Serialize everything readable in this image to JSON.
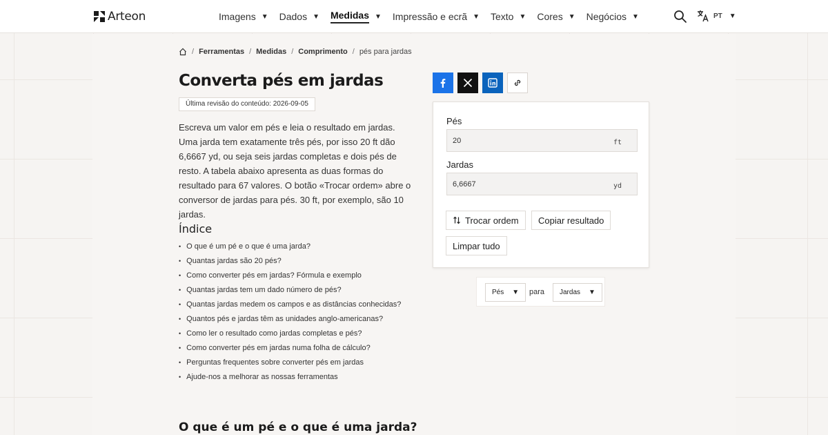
{
  "header": {
    "brand": "Arteon",
    "nav": [
      {
        "label": "Imagens",
        "active": false
      },
      {
        "label": "Dados",
        "active": false
      },
      {
        "label": "Medidas",
        "active": true
      },
      {
        "label": "Impressão e ecrã",
        "active": false
      },
      {
        "label": "Texto",
        "active": false
      },
      {
        "label": "Cores",
        "active": false
      },
      {
        "label": "Negócios",
        "active": false
      }
    ],
    "language": "PT",
    "icons": {
      "search": "search-icon",
      "language": "translate-icon",
      "home": "home-icon"
    }
  },
  "breadcrumb": {
    "items": [
      "Ferramentas",
      "Medidas",
      "Comprimento"
    ],
    "current": "pés para jardas"
  },
  "page": {
    "title": "Converta pés em jardas",
    "revision": "Última revisão do conteúdo: 2026-09-05",
    "intro": "Escreva um valor em pés e leia o resultado em jardas. Uma jarda tem exatamente três pés, por isso 20 ft dão 6,6667 yd, ou seja seis jardas completas e dois pés de resto. A tabela abaixo apresenta as duas formas do resultado para 67 valores. O botão «Trocar ordem» abre o conversor de jardas para pés. 30 ft, por exemplo, são 10 jardas.",
    "toc_title": "Índice",
    "toc": [
      "O que é um pé e o que é uma jarda?",
      "Quantas jardas são 20 pés?",
      "Como converter pés em jardas? Fórmula e exemplo",
      "Quantas jardas tem um dado número de pés?",
      "Quantas jardas medem os campos e as distâncias conhecidas?",
      "Quantos pés e jardas têm as unidades anglo-americanas?",
      "Como ler o resultado como jardas completas e pés?",
      "Como converter pés em jardas numa folha de cálculo?",
      "Perguntas frequentes sobre converter pés em jardas",
      "Ajude-nos a melhorar as nossas ferramentas"
    ],
    "section_heading": "O que é um pé e o que é uma jarda?"
  },
  "share": {
    "icons": [
      "facebook-icon",
      "x-icon",
      "linkedin-icon",
      "link-icon"
    ],
    "colors": {
      "facebook": "#1b73e8",
      "x": "#111111",
      "linkedin": "#0a63bc"
    }
  },
  "converter": {
    "from_label": "Pés",
    "from_value": "20",
    "from_unit": "ft",
    "to_label": "Jardas",
    "to_value": "6,6667",
    "to_unit": "yd",
    "swap_label": "Trocar ordem",
    "copy_label": "Copiar resultado",
    "clear_label": "Limpar tudo"
  },
  "unit_select": {
    "from": "Pés",
    "connector": "para",
    "to": "Jardas"
  }
}
